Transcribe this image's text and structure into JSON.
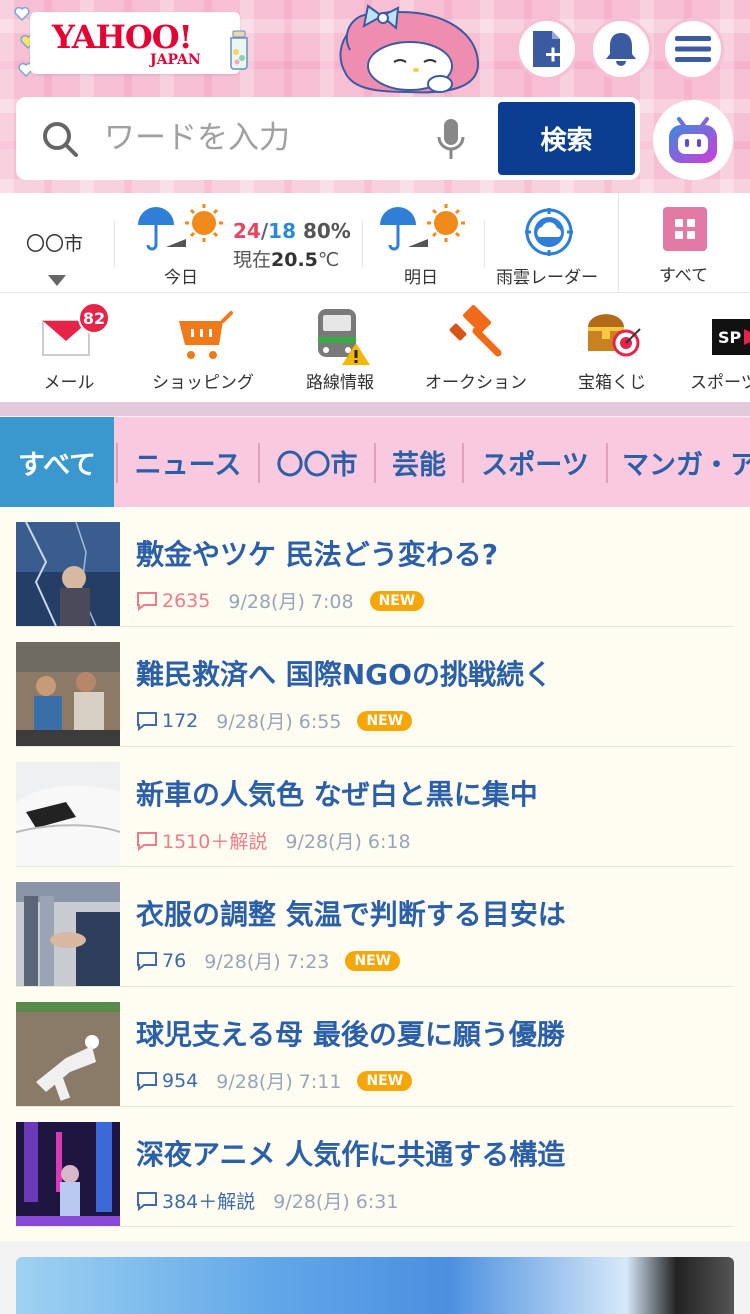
{
  "header": {
    "logo_main": "YAHOO!",
    "logo_sub": "JAPAN",
    "search_placeholder": "ワードを入力",
    "search_button": "検索"
  },
  "weather": {
    "city": "〇〇市",
    "today_label": "今日",
    "tomorrow_label": "明日",
    "high": "24",
    "slash": "/",
    "low": "18",
    "precip": "80%",
    "now_prefix": "現在",
    "now_temp": "20.5",
    "now_unit": "℃",
    "radar_label": "雨雲レーダー",
    "all_label": "すべて"
  },
  "services": [
    {
      "label": "メール",
      "badge": "82"
    },
    {
      "label": "ショッピング"
    },
    {
      "label": "路線情報"
    },
    {
      "label": "オークション"
    },
    {
      "label": "宝箱くじ"
    },
    {
      "label": "スポーツ"
    }
  ],
  "tabs": [
    "すべて",
    "ニュース",
    "〇〇市",
    "芸能",
    "スポーツ",
    "マンガ・ア"
  ],
  "news": [
    {
      "title": "敷金やツケ 民法どう変わる?",
      "comments": "2635",
      "comment_style": "hot",
      "time": "9/28(月) 7:08",
      "badge": "NEW"
    },
    {
      "title": "難民救済へ 国際NGOの挑戦続く",
      "comments": "172",
      "comment_style": "cold",
      "time": "9/28(月) 6:55",
      "badge": "NEW"
    },
    {
      "title": "新車の人気色 なぜ白と黒に集中",
      "comments": "1510＋解説",
      "comment_style": "hot",
      "time": "9/28(月) 6:18",
      "badge": ""
    },
    {
      "title": "衣服の調整 気温で判断する目安は",
      "comments": "76",
      "comment_style": "cold",
      "time": "9/28(月) 7:23",
      "badge": "NEW"
    },
    {
      "title": "球児支える母 最後の夏に願う優勝",
      "comments": "954",
      "comment_style": "cold",
      "time": "9/28(月) 7:11",
      "badge": "NEW"
    },
    {
      "title": "深夜アニメ 人気作に共通する構造",
      "comments": "384＋解説",
      "comment_style": "cold",
      "time": "9/28(月) 6:31",
      "badge": ""
    }
  ]
}
